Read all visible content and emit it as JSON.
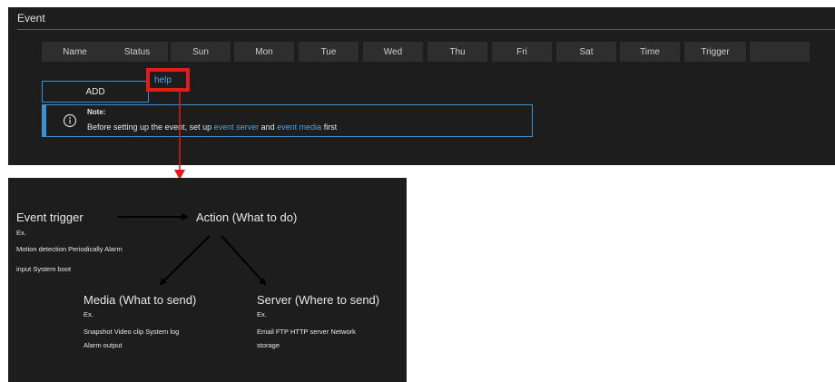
{
  "event_panel": {
    "title": "Event",
    "columns": [
      "Name",
      "Status",
      "Sun",
      "Mon",
      "Tue",
      "Wed",
      "Thu",
      "Fri",
      "Sat",
      "Time",
      "Trigger",
      ""
    ],
    "add_label": "ADD",
    "help_label": "help",
    "note": {
      "title": "Note:",
      "text_before": "Before setting up the event, set up ",
      "link1": "event server",
      "text_mid": " and ",
      "link2": "event media",
      "text_after": " first"
    }
  },
  "diagram": {
    "event_trigger": {
      "title": "Event trigger",
      "ex": "Ex.",
      "line1": "Motion detection  Periodically  Alarm",
      "line2": "input  System boot"
    },
    "action": {
      "title": "Action (What to do)"
    },
    "media": {
      "title": "Media (What to send)",
      "ex": "Ex.",
      "line1": "Snapshot  Video clip  System log",
      "line2": "Alarm output"
    },
    "server": {
      "title": "Server (Where to send)",
      "ex": "Ex.",
      "line1": "Email  FTP  HTTP server  Network",
      "line2": "storage"
    }
  },
  "colors": {
    "panel_bg": "#1d1d1d",
    "accent_blue": "#3d8fd1",
    "link_blue": "#4aa3e6",
    "highlight_red": "#e21b1b"
  },
  "icons": {
    "info": "info-circle-icon"
  }
}
